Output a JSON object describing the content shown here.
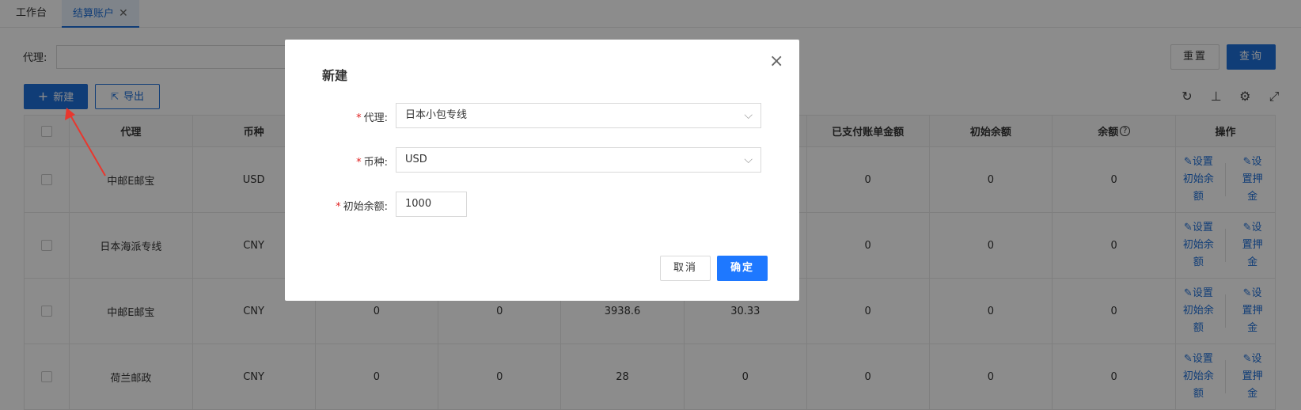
{
  "tabs": [
    {
      "label": "工作台"
    },
    {
      "label": "结算账户",
      "close": "✕"
    }
  ],
  "filter": {
    "agent_label": "代理:",
    "agent_value": "",
    "reset_label": "重置",
    "query_label": "查询"
  },
  "actions": {
    "new_label": "新建",
    "export_label": "导出"
  },
  "table": {
    "headers": {
      "agent": "代理",
      "currency": "币种",
      "paid_amount": "已支付账单金额",
      "initial_balance": "初始余额",
      "balance": "余额",
      "ops": "操作"
    },
    "rows": [
      {
        "agent": "中邮E邮宝",
        "currency": "USD",
        "a": "",
        "b": "",
        "c": "",
        "d": "",
        "paid": "0",
        "initial": "0",
        "balance": "0"
      },
      {
        "agent": "日本海派专线",
        "currency": "CNY",
        "a": "",
        "b": "",
        "c": "",
        "d": "",
        "paid": "0",
        "initial": "0",
        "balance": "0"
      },
      {
        "agent": "中邮E邮宝",
        "currency": "CNY",
        "a": "0",
        "b": "0",
        "c": "3938.6",
        "d": "30.33",
        "paid": "0",
        "initial": "0",
        "balance": "0"
      },
      {
        "agent": "荷兰邮政",
        "currency": "CNY",
        "a": "0",
        "b": "0",
        "c": "28",
        "d": "0",
        "paid": "0",
        "initial": "0",
        "balance": "0"
      }
    ],
    "op_set_initial": [
      "设置",
      "初始余",
      "额"
    ],
    "op_set_deposit": [
      "设",
      "置押",
      "金"
    ]
  },
  "modal": {
    "title": "新建",
    "agent_label": "代理:",
    "agent_value": "日本小包专线",
    "currency_label": "币种:",
    "currency_value": "USD",
    "initial_label": "初始余额:",
    "initial_value": "1000",
    "cancel_label": "取消",
    "ok_label": "确定"
  }
}
